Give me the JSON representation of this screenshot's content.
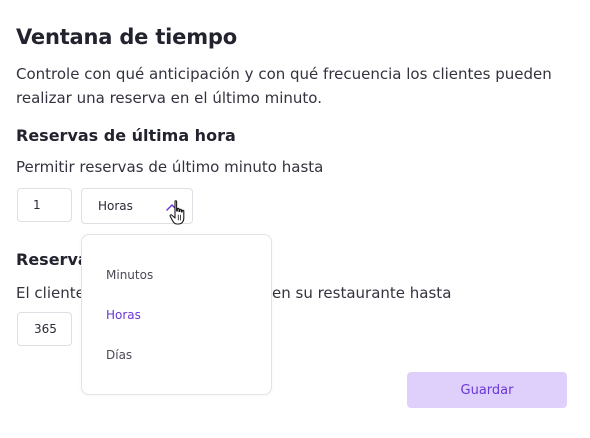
{
  "header": {
    "title": "Ventana de tiempo",
    "description": "Controle con qué anticipación y con qué frecuencia los clientes pueden realizar una reserva en el último minuto."
  },
  "last_minute": {
    "heading": "Reservas de última hora",
    "text": "Permitir reservas de último minuto hasta",
    "quantity_value": "1",
    "unit_selected": "Horas"
  },
  "advance": {
    "heading_visible": "Reserva",
    "text_left_visible": "El cliente",
    "text_right_visible": "en su restaurante hasta",
    "quantity_value": "365"
  },
  "dropdown": {
    "options": [
      "Minutos",
      "Horas",
      "Días"
    ],
    "selected": "Horas"
  },
  "actions": {
    "save_label": "Guardar"
  },
  "colors": {
    "accent": "#6a37d6",
    "button_bg": "#dfd0fb",
    "border": "#dedee4",
    "text": "#33333f"
  },
  "icons": {
    "chevron": "chevron-up-icon",
    "cursor": "hand-pointer-cursor-icon"
  }
}
